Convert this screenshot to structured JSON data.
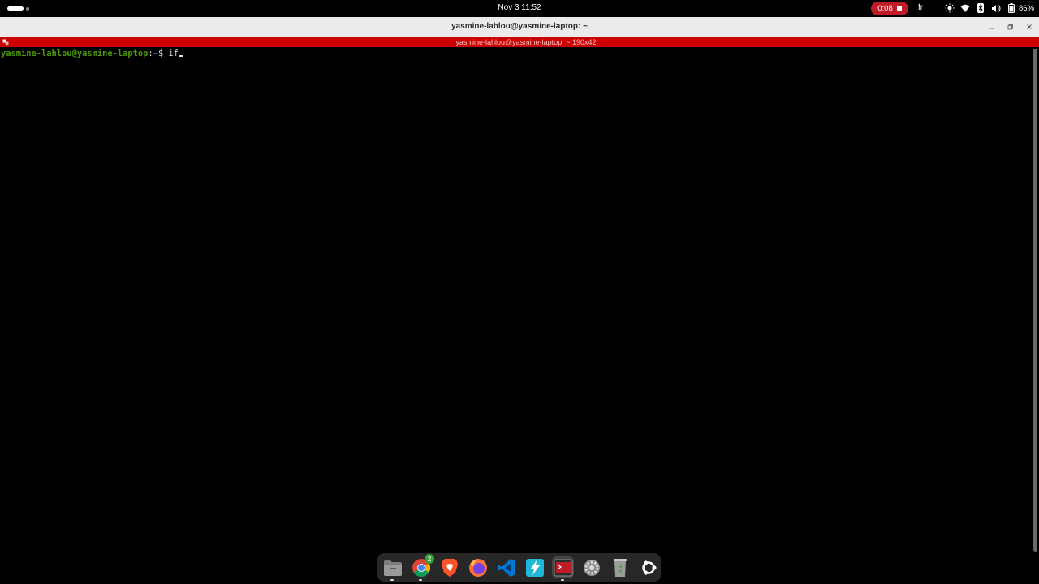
{
  "topbar": {
    "clock": "Nov 3  11:52",
    "recording_time": "0:08",
    "language": "fr",
    "battery_percent": "86%",
    "tray_icons": [
      "brightness-icon",
      "wifi-icon",
      "bluetooth-icon",
      "volume-icon",
      "battery-icon"
    ]
  },
  "window": {
    "title": "yasmine-lahlou@yasmine-laptop: ~",
    "status_text": "yasmine-lahlou@yasmine-laptop: ~ 190x42"
  },
  "terminal": {
    "prompt_user": "yasmine-lahlou@yasmine-laptop",
    "prompt_sep": ":",
    "prompt_path": "~",
    "prompt_symbol": "$ ",
    "command": "if"
  },
  "dock": {
    "items": [
      {
        "name": "files",
        "running": true
      },
      {
        "name": "chrome",
        "running": true,
        "badge": "2"
      },
      {
        "name": "brave",
        "running": false
      },
      {
        "name": "firefox",
        "running": false
      },
      {
        "name": "vscode",
        "running": false
      },
      {
        "name": "bolt",
        "running": false
      },
      {
        "name": "terminal",
        "running": true,
        "active": true
      },
      {
        "name": "settings",
        "running": false
      },
      {
        "name": "trash",
        "running": false
      },
      {
        "name": "ubuntu",
        "running": false
      }
    ]
  },
  "colors": {
    "prompt_user": "#4e9a06",
    "prompt_path": "#3465a4",
    "terminal_bar": "#cc0000",
    "record_badge": "#c01c28"
  }
}
